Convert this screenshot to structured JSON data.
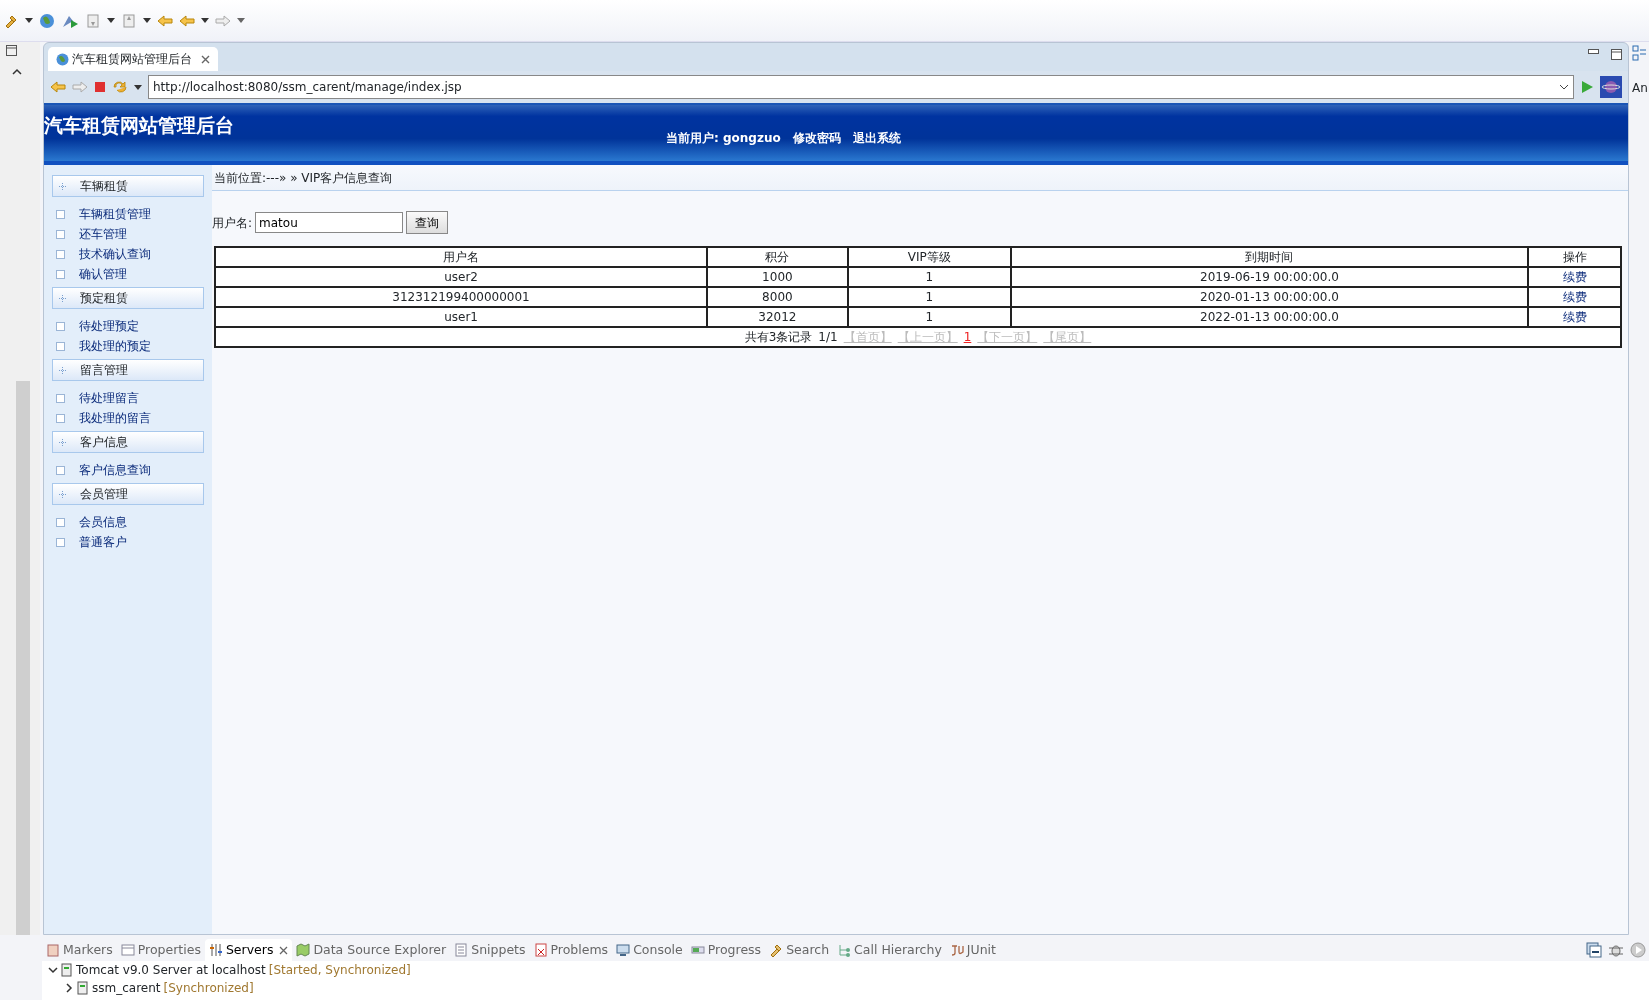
{
  "browser": {
    "tab": {
      "title": "汽车租赁网站管理后台"
    },
    "url": "http://localhost:8080/ssm_carent/manage/index.jsp"
  },
  "site": {
    "title": "汽车租赁网站管理后台",
    "user_label": "当前用户:",
    "username": "gongzuo",
    "links": [
      "修改密码",
      "退出系统"
    ]
  },
  "sidebar": [
    {
      "title": "车辆租赁",
      "items": [
        "车辆租赁管理",
        "还车管理",
        "技术确认查询",
        "确认管理"
      ]
    },
    {
      "title": "预定租赁",
      "items": [
        "待处理预定",
        "我处理的预定"
      ]
    },
    {
      "title": "留言管理",
      "items": [
        "待处理留言",
        "我处理的留言"
      ]
    },
    {
      "title": "客户信息",
      "items": [
        "客户信息查询"
      ]
    },
    {
      "title": "会员管理",
      "items": [
        "会员信息",
        "普通客户"
      ]
    }
  ],
  "breadcrumb": "当前位置:---» » VIP客户信息查询",
  "search": {
    "label": "用户名:",
    "value": "matou",
    "button": "查询"
  },
  "table": {
    "columns": [
      "用户名",
      "积分",
      "VIP等级",
      "到期时间",
      "操作"
    ],
    "rows": [
      [
        "user2",
        "1000",
        "1",
        "2019-06-19 00:00:00.0",
        "续费"
      ],
      [
        "312312199400000001",
        "8000",
        "1",
        "2020-01-13 00:00:00.0",
        "续费"
      ],
      [
        "user1",
        "32012",
        "1",
        "2022-01-13 00:00:00.0",
        "续费"
      ]
    ]
  },
  "pager": {
    "summary": "共有3条记录",
    "page": "1/1",
    "items": [
      {
        "label": "【首页】",
        "kind": "link"
      },
      {
        "label": "【上一页】",
        "kind": "link"
      },
      {
        "label": "1",
        "kind": "current"
      },
      {
        "label": "【下一页】",
        "kind": "link"
      },
      {
        "label": "【尾页】",
        "kind": "link"
      }
    ]
  },
  "bottom_panel": {
    "tabs": [
      {
        "label": "Markers",
        "selected": false
      },
      {
        "label": "Properties",
        "selected": false
      },
      {
        "label": "Servers",
        "selected": true
      },
      {
        "label": "Data Source Explorer",
        "selected": false
      },
      {
        "label": "Snippets",
        "selected": false
      },
      {
        "label": "Problems",
        "selected": false
      },
      {
        "label": "Console",
        "selected": false
      },
      {
        "label": "Progress",
        "selected": false
      },
      {
        "label": "Search",
        "selected": false
      },
      {
        "label": "Call Hierarchy",
        "selected": false
      },
      {
        "label": "JUnit",
        "selected": false
      }
    ],
    "tree": [
      {
        "label": "Tomcat v9.0 Server at localhost",
        "status": "[Started, Synchronized]",
        "expanded": true,
        "children": [
          {
            "label": "ssm_carent",
            "status": "[Synchronized]",
            "expanded": false
          }
        ]
      }
    ]
  },
  "right_strip": {
    "label": "An"
  }
}
